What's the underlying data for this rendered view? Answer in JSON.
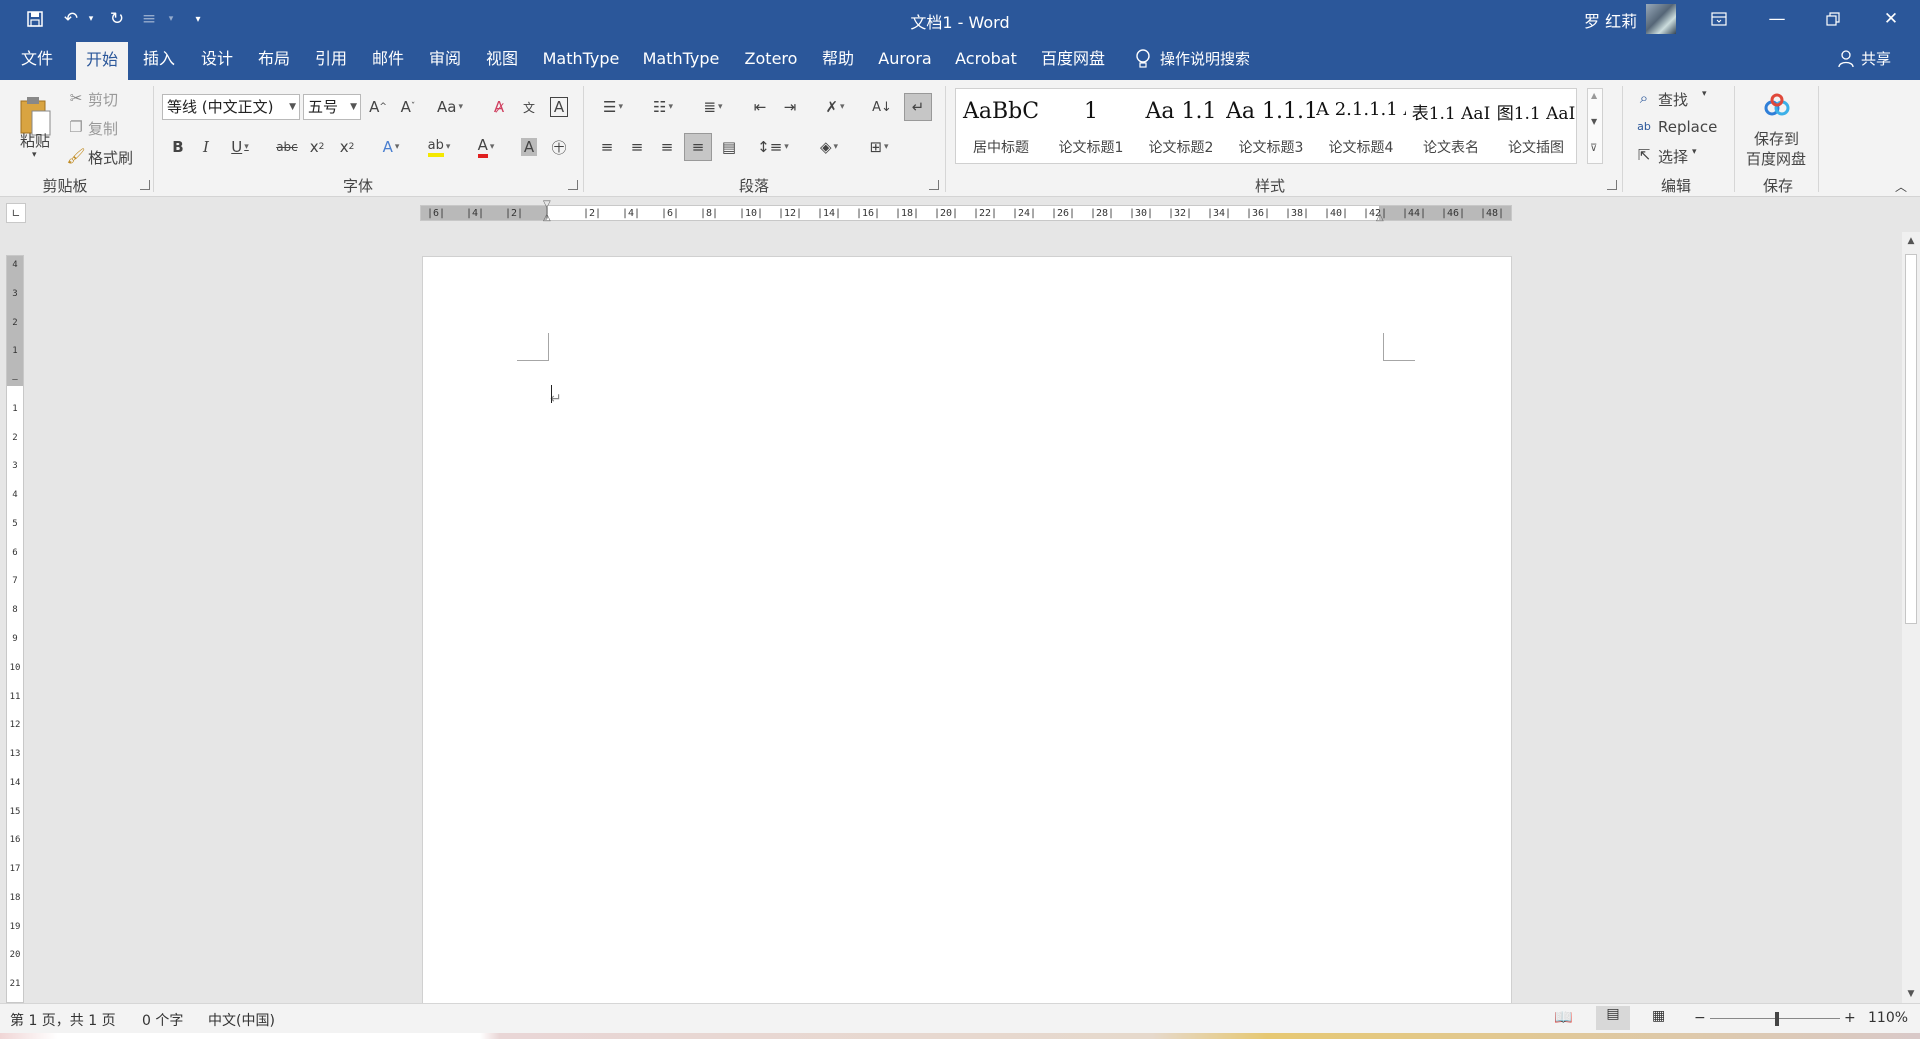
{
  "window": {
    "title": "文档1  -  Word",
    "user_name": "罗 红莉"
  },
  "tabs": [
    "文件",
    "开始",
    "插入",
    "设计",
    "布局",
    "引用",
    "邮件",
    "审阅",
    "视图",
    "MathType",
    "MathType",
    "Zotero",
    "帮助",
    "Aurora",
    "Acrobat",
    "百度网盘"
  ],
  "tell_me": "操作说明搜索",
  "share_label": "共享",
  "clipboard": {
    "paste": "粘贴",
    "cut": "剪切",
    "copy": "复制",
    "format_painter": "格式刷",
    "group": "剪贴板"
  },
  "font": {
    "name": "等线 (中文正文)",
    "size": "五号",
    "group": "字体"
  },
  "paragraph": {
    "group": "段落"
  },
  "styles": {
    "group": "样式",
    "items": [
      {
        "sample": "AaBbC",
        "name": "居中标题"
      },
      {
        "sample": "1",
        "name": "论文标题1"
      },
      {
        "sample": "Aa",
        "name": "论文标题2"
      },
      {
        "sample": "1.1",
        "name": "论文标题3"
      },
      {
        "sample": "Aa",
        "name": "论文标题4"
      },
      {
        "sample": "1.1.1",
        "name": "论文表名"
      },
      {
        "sample": "A",
        "name": "论文插图"
      }
    ],
    "samples_row": [
      "AaBbC",
      "1",
      "Aa",
      "1.1",
      "Aa",
      "1.1.1",
      "A",
      "2.1.1.1",
      "A",
      "表1.1",
      "AaI",
      "图1.1",
      "AaI"
    ]
  },
  "editing": {
    "find": "查找",
    "replace": "Replace",
    "select": "选择",
    "group": "编辑"
  },
  "save_group": {
    "save_to": "保存到",
    "baidu": "百度网盘",
    "group": "保存"
  },
  "ruler": {
    "h_ticks": [
      "6",
      "4",
      "2",
      "",
      "2",
      "4",
      "6",
      "8",
      "10",
      "12",
      "14",
      "16",
      "18",
      "20",
      "22",
      "24",
      "26",
      "28",
      "30",
      "32",
      "34",
      "36",
      "38",
      "40",
      "42",
      "44",
      "46",
      "48"
    ],
    "v_ticks": [
      "4",
      "3",
      "2",
      "1",
      "",
      "1",
      "2",
      "3",
      "4",
      "5",
      "6",
      "7",
      "8",
      "9",
      "10",
      "11",
      "12",
      "13",
      "14",
      "15",
      "16",
      "17",
      "18",
      "19",
      "20",
      "21"
    ]
  },
  "status": {
    "page": "第 1 页，共 1 页",
    "words": "0 个字",
    "language": "中文(中国)",
    "zoom": "110%"
  }
}
